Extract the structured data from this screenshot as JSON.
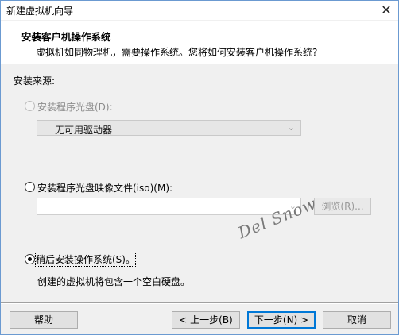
{
  "window": {
    "title": "新建虚拟机向导",
    "close_glyph": "✕"
  },
  "header": {
    "title": "安装客户机操作系统",
    "subtitle": "虚拟机如同物理机，需要操作系统。您将如何安装客户机操作系统?"
  },
  "source": {
    "label": "安装来源:",
    "option_disc": {
      "label": "安装程序光盘(D):",
      "selected": false,
      "enabled": false
    },
    "disc_combo": {
      "value": "无可用驱动器"
    },
    "option_iso": {
      "label": "安装程序光盘映像文件(iso)(M):",
      "selected": false,
      "enabled": true
    },
    "iso_path": {
      "value": "",
      "placeholder": ""
    },
    "browse_button": "浏览(R)...",
    "option_later": {
      "label": "稍后安装操作系统(S)。",
      "selected": true,
      "enabled": true
    },
    "later_description": "创建的虚拟机将包含一个空白硬盘。"
  },
  "watermark": "Del Snow",
  "footer": {
    "help": "帮助",
    "back": "< 上一步(B)",
    "next": "下一步(N) >",
    "cancel": "取消"
  }
}
